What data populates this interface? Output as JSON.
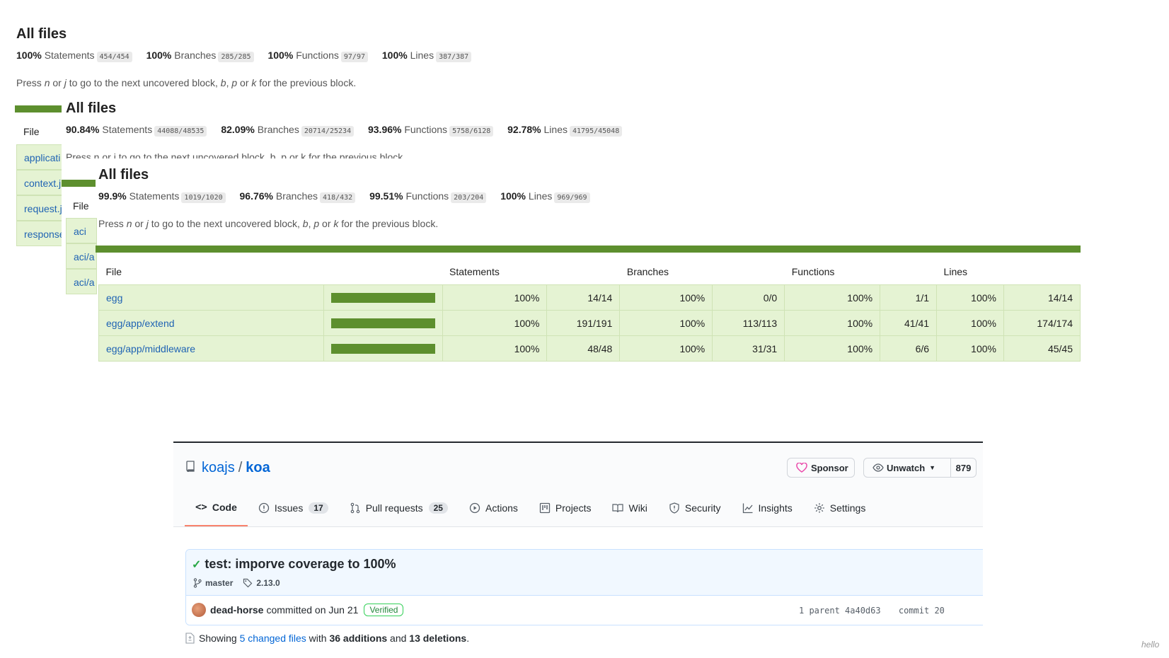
{
  "report1": {
    "title": "All files",
    "stats": [
      {
        "pct": "100%",
        "label": "Statements",
        "frac": "454/454"
      },
      {
        "pct": "100%",
        "label": "Branches",
        "frac": "285/285"
      },
      {
        "pct": "100%",
        "label": "Functions",
        "frac": "97/97"
      },
      {
        "pct": "100%",
        "label": "Lines",
        "frac": "387/387"
      }
    ],
    "hint_parts": [
      "Press ",
      "n",
      " or ",
      "j",
      " to go to the next uncovered block, ",
      "b",
      ", ",
      "p",
      " or ",
      "k",
      " for the previous block."
    ],
    "file_header": "File",
    "files": [
      "applicati",
      "context.j",
      "request.j",
      "response"
    ]
  },
  "report2": {
    "title": "All files",
    "stats": [
      {
        "pct": "90.84%",
        "label": "Statements",
        "frac": "44088/48535"
      },
      {
        "pct": "82.09%",
        "label": "Branches",
        "frac": "20714/25234"
      },
      {
        "pct": "93.96%",
        "label": "Functions",
        "frac": "5758/6128"
      },
      {
        "pct": "92.78%",
        "label": "Lines",
        "frac": "41795/45048"
      }
    ],
    "hint": "Press n or j to go to the next uncovered block, b, p or k for the previous block.",
    "file_header": "File",
    "files": [
      "aci",
      "aci/a",
      "aci/a"
    ]
  },
  "report3": {
    "title": "All files",
    "stats": [
      {
        "pct": "99.9%",
        "label": "Statements",
        "frac": "1019/1020"
      },
      {
        "pct": "96.76%",
        "label": "Branches",
        "frac": "418/432"
      },
      {
        "pct": "99.51%",
        "label": "Functions",
        "frac": "203/204"
      },
      {
        "pct": "100%",
        "label": "Lines",
        "frac": "969/969"
      }
    ],
    "hint_parts": [
      "Press ",
      "n",
      " or ",
      "j",
      " to go to the next uncovered block, ",
      "b",
      ", ",
      "p",
      " or ",
      "k",
      " for the previous block."
    ],
    "columns": [
      "File",
      "Statements",
      "Branches",
      "Functions",
      "Lines"
    ],
    "rows": [
      {
        "file": "egg",
        "bar_pct": 100,
        "stmt_pct": "100%",
        "stmt": "14/14",
        "br_pct": "100%",
        "br": "0/0",
        "fn_pct": "100%",
        "fn": "1/1",
        "ln_pct": "100%",
        "ln": "14/14"
      },
      {
        "file": "egg/app/extend",
        "bar_pct": 100,
        "stmt_pct": "100%",
        "stmt": "191/191",
        "br_pct": "100%",
        "br": "113/113",
        "fn_pct": "100%",
        "fn": "41/41",
        "ln_pct": "100%",
        "ln": "174/174"
      },
      {
        "file": "egg/app/middleware",
        "bar_pct": 100,
        "stmt_pct": "100%",
        "stmt": "48/48",
        "br_pct": "100%",
        "br": "31/31",
        "fn_pct": "100%",
        "fn": "6/6",
        "ln_pct": "100%",
        "ln": "45/45"
      }
    ]
  },
  "github": {
    "owner": "koajs",
    "separator": "/",
    "repo": "koa",
    "sponsor_label": "Sponsor",
    "watch_label": "Unwatch",
    "watch_count": "879",
    "tabs": [
      {
        "icon": "code-icon",
        "label": "Code",
        "count": ""
      },
      {
        "icon": "issue-icon",
        "label": "Issues",
        "count": "17"
      },
      {
        "icon": "pull-request-icon",
        "label": "Pull requests",
        "count": "25"
      },
      {
        "icon": "actions-icon",
        "label": "Actions",
        "count": ""
      },
      {
        "icon": "projects-icon",
        "label": "Projects",
        "count": ""
      },
      {
        "icon": "wiki-icon",
        "label": "Wiki",
        "count": ""
      },
      {
        "icon": "security-icon",
        "label": "Security",
        "count": ""
      },
      {
        "icon": "insights-icon",
        "label": "Insights",
        "count": ""
      },
      {
        "icon": "settings-icon",
        "label": "Settings",
        "count": ""
      }
    ],
    "commit": {
      "title": "test: imporve coverage to 100%",
      "branch": "master",
      "tag": "2.13.0",
      "author": "dead-horse",
      "committed_text": "committed on Jun 21",
      "verified": "Verified",
      "parent_label": "1 parent",
      "parent_sha": "4a40d63",
      "commit_label": "commit",
      "commit_sha": "20"
    },
    "summary": {
      "showing": "Showing",
      "changed": "5 changed files",
      "with": "with",
      "additions": "36 additions",
      "and": "and",
      "deletions": "13 deletions",
      "end": "."
    }
  },
  "watermark": "hello",
  "colors": {
    "coverage_green": "#5d8f2e",
    "row_green": "#e5f3d3",
    "link_blue": "#1f63b3",
    "tab_underline": "#f9826c"
  }
}
